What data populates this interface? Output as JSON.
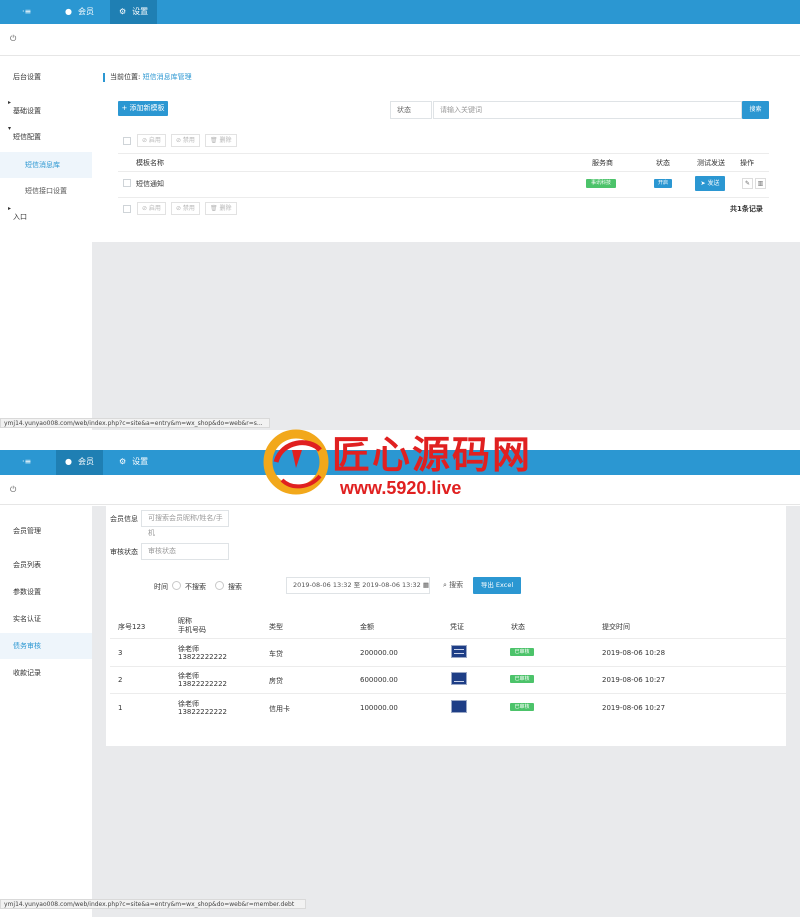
{
  "shot1": {
    "topbar": {
      "menu_icon": "·≡",
      "nav": [
        {
          "icon": "user-icon",
          "label": "会员"
        },
        {
          "icon": "gear-icon",
          "label": "设置"
        }
      ]
    },
    "power_icon": "⏻",
    "sidebar": [
      {
        "label": "后台设置"
      },
      {
        "label": "基础设置"
      },
      {
        "label": "短信配置"
      },
      {
        "label": "短信消息库"
      },
      {
        "label": "短信接口设置"
      },
      {
        "label": "入口"
      }
    ],
    "breadcrumb": {
      "prefix": "当前位置:",
      "current": "短信消息库管理"
    },
    "add_button": "+ 添加新模板",
    "filter": {
      "status_label": "状态",
      "search_placeholder": "请输入关键词",
      "search_button": "搜索"
    },
    "bulk": {
      "enable": "⊘ 启用",
      "disable": "⊘ 禁用",
      "delete": "🗑 删除"
    },
    "table": {
      "headers": {
        "name": "模板名称",
        "provider": "服务商",
        "status": "状态",
        "test": "测试发送",
        "actions": "操作"
      },
      "rows": [
        {
          "name": "短信通知",
          "provider": "事讯科技",
          "status": "开启",
          "test": "发送"
        }
      ]
    },
    "total": "共1条记录",
    "status_url": "ymj14.yunyao008.com/web/index.php?c=site&a=entry&m=wx_shop&do=web&r=s..."
  },
  "shot2": {
    "topbar": {
      "menu_icon": "·≡",
      "nav": [
        {
          "icon": "user-icon",
          "label": "会员"
        },
        {
          "icon": "gear-icon",
          "label": "设置"
        }
      ]
    },
    "power_icon": "⏻",
    "sidebar": [
      {
        "label": "会员管理"
      },
      {
        "label": "会员列表"
      },
      {
        "label": "参数设置"
      },
      {
        "label": "实名认证"
      },
      {
        "label": "债务审核"
      },
      {
        "label": "收款记录"
      }
    ],
    "filters": {
      "member_label": "会员信息",
      "member_placeholder": "可搜索会员昵称/姓名/手机",
      "audit_label": "审核状态",
      "audit_placeholder": "审核状态",
      "time_label": "时间",
      "radio_no": "不搜索",
      "radio_yes": "搜索",
      "date_range": "2019-08-06 13:32 至 2019-08-06 13:32",
      "search_button": "搜索",
      "export_button": "导出 Excel"
    },
    "table": {
      "headers": {
        "seq": "序号123",
        "nick": "昵称",
        "phone": "手机号码",
        "type": "类型",
        "amount": "金额",
        "voucher": "凭证",
        "status": "状态",
        "time": "提交时间"
      },
      "rows": [
        {
          "seq": "3",
          "nick": "徐老师",
          "phone": "13822222222",
          "type": "车贷",
          "amount": "200000.00",
          "status": "已审核",
          "time": "2019-08-06 10:28"
        },
        {
          "seq": "2",
          "nick": "徐老师",
          "phone": "13822222222",
          "type": "房贷",
          "amount": "600000.00",
          "status": "已审核",
          "time": "2019-08-06 10:27"
        },
        {
          "seq": "1",
          "nick": "徐老师",
          "phone": "13822222222",
          "type": "信用卡",
          "amount": "100000.00",
          "status": "已审核",
          "time": "2019-08-06 10:27"
        }
      ]
    },
    "status_url": "ymj14.yunyao008.com/web/index.php?c=site&a=entry&m=wx_shop&do=web&r=member.debt"
  },
  "watermark": {
    "text": "匠心源码网",
    "url": "www.5920.live"
  },
  "colors": {
    "primary": "#2b97d2",
    "success": "#4cc36a",
    "gray_bg": "#e9eaec"
  }
}
